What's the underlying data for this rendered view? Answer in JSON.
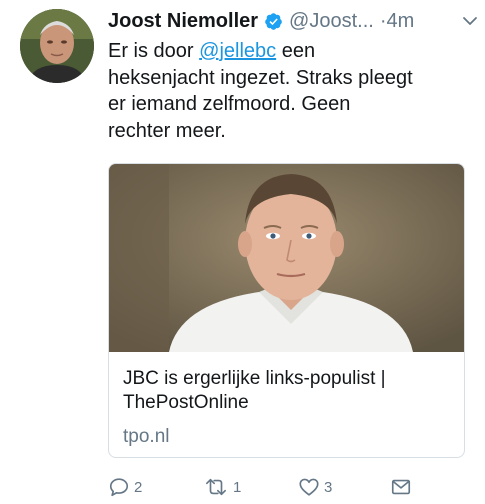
{
  "tweet": {
    "display_name": "Joost Niemoller",
    "verified": true,
    "handle": "@Joost...",
    "time": "·4m",
    "text_lines": [
      {
        "before": "Er is door ",
        "mention": "@jellebc",
        "after": " een"
      },
      {
        "text": "heksenjacht ingezet. Straks pleegt"
      },
      {
        "text": "er iemand zelfmoord. Geen"
      },
      {
        "text": "rechter meer."
      }
    ]
  },
  "card": {
    "title_lines": [
      "JBC is ergerlijke links-populist |",
      "ThePostOnline"
    ],
    "domain": "tpo.nl"
  },
  "actions": {
    "reply_count": "2",
    "retweet_count": "1",
    "like_count": "3"
  },
  "icons": {
    "avatar": "avatar-photo",
    "verified": "verified-badge-icon",
    "more": "chevron-down-icon",
    "reply": "reply-icon",
    "retweet": "retweet-icon",
    "like": "heart-icon",
    "message": "envelope-icon"
  },
  "colors": {
    "link": "#1b95e0",
    "secondary_text": "#657786",
    "primary_text": "#14171a",
    "card_border": "#d8dfe4"
  }
}
